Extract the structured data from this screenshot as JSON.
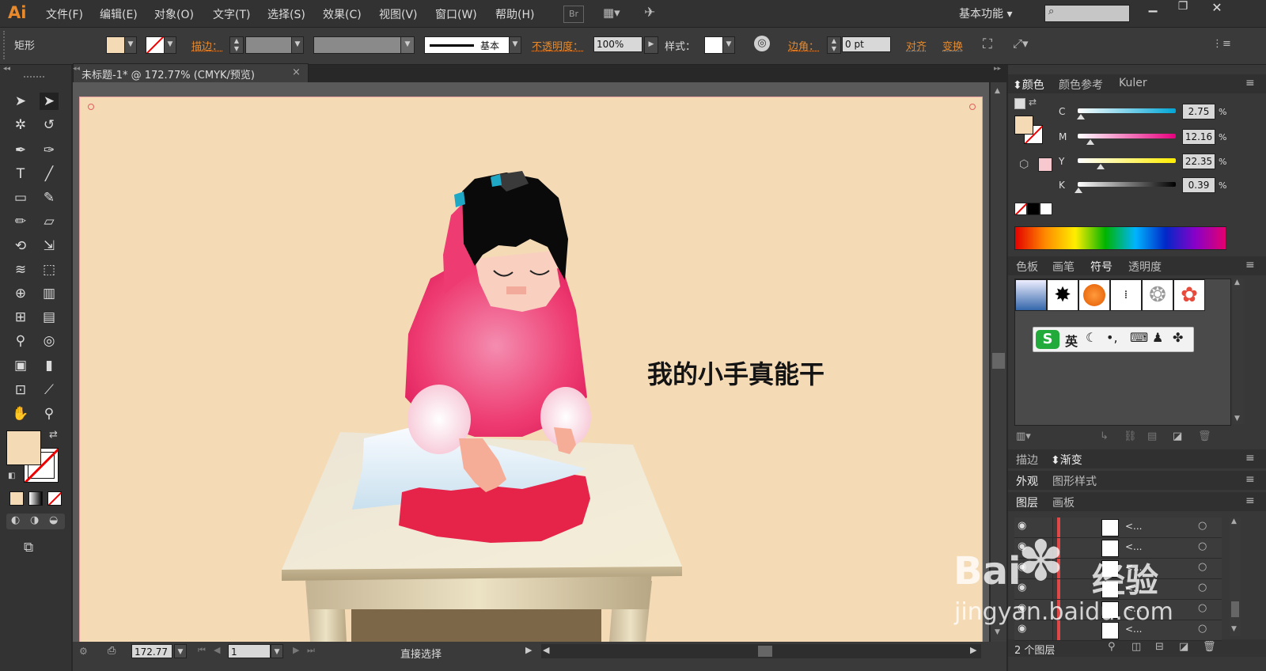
{
  "app": {
    "logo": "Ai",
    "menus": [
      "文件(F)",
      "编辑(E)",
      "对象(O)",
      "文字(T)",
      "选择(S)",
      "效果(C)",
      "视图(V)",
      "窗口(W)",
      "帮助(H)"
    ],
    "bridge_label": "Br",
    "workspace": "基本功能"
  },
  "control_bar": {
    "object_type": "矩形",
    "stroke_label": "描边：",
    "stroke_style": "基本",
    "opacity_label": "不透明度：",
    "opacity_value": "100%",
    "style_label": "样式：",
    "corner_label": "边角：",
    "corner_value": "0 pt",
    "align_label": "对齐",
    "transform_label": "变换"
  },
  "document": {
    "tab_title": "未标题-1* @ 172.77% (CMYK/预览)",
    "close": "×",
    "heading": "我的小手真能干"
  },
  "statusbar": {
    "zoom": "172.77",
    "page": "1",
    "tool_status": "直接选择"
  },
  "color_panel": {
    "tabs": [
      "颜色",
      "颜色参考",
      "Kuler"
    ],
    "channels": [
      {
        "name": "C",
        "value": "2.75",
        "percent": 2.75,
        "gradient": "linear-gradient(90deg,#fff,#00a6d6)"
      },
      {
        "name": "M",
        "value": "12.16",
        "percent": 12.16,
        "gradient": "linear-gradient(90deg,#fff,#e6007e)"
      },
      {
        "name": "Y",
        "value": "22.35",
        "percent": 22.35,
        "gradient": "linear-gradient(90deg,#fff,#ffed00)"
      },
      {
        "name": "K",
        "value": "0.39",
        "percent": 0.39,
        "gradient": "linear-gradient(90deg,#fff,#000)"
      }
    ],
    "percent_sign": "%",
    "fill_color": "#f5dab6"
  },
  "swatch_panel": {
    "tabs": [
      "色板",
      "画笔",
      "符号",
      "透明度"
    ],
    "ime_label": "英"
  },
  "panels": {
    "stroke_tab": "描边",
    "gradient_tab": "渐变",
    "appearance_tab": "外观",
    "graphic_styles_tab": "图形样式",
    "layers_tab": "图层",
    "artboards_tab": "画板"
  },
  "layers": {
    "rows": [
      "<...",
      "<...",
      "<...",
      "<...",
      "<...",
      "<..."
    ],
    "count_label": "2 个图层"
  },
  "watermark": {
    "brand": "Bai",
    "brand2": "经验",
    "url": "jingyan.baidu.com"
  }
}
